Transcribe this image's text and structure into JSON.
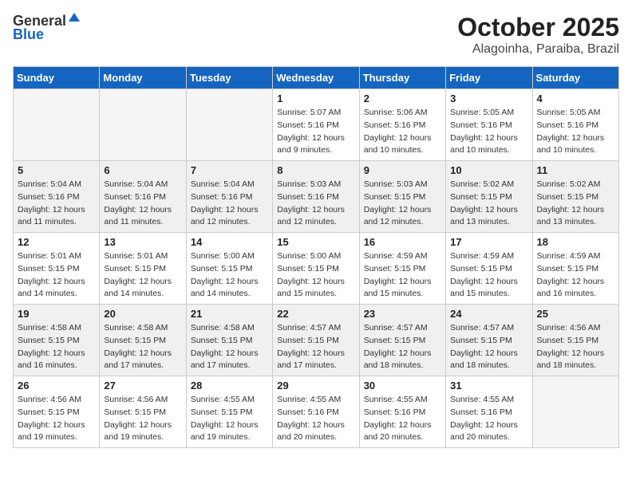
{
  "header": {
    "logo_general": "General",
    "logo_blue": "Blue",
    "title": "October 2025",
    "location": "Alagoinha, Paraiba, Brazil"
  },
  "weekdays": [
    "Sunday",
    "Monday",
    "Tuesday",
    "Wednesday",
    "Thursday",
    "Friday",
    "Saturday"
  ],
  "weeks": [
    [
      {
        "day": "",
        "info": ""
      },
      {
        "day": "",
        "info": ""
      },
      {
        "day": "",
        "info": ""
      },
      {
        "day": "1",
        "info": "Sunrise: 5:07 AM\nSunset: 5:16 PM\nDaylight: 12 hours\nand 9 minutes."
      },
      {
        "day": "2",
        "info": "Sunrise: 5:06 AM\nSunset: 5:16 PM\nDaylight: 12 hours\nand 10 minutes."
      },
      {
        "day": "3",
        "info": "Sunrise: 5:05 AM\nSunset: 5:16 PM\nDaylight: 12 hours\nand 10 minutes."
      },
      {
        "day": "4",
        "info": "Sunrise: 5:05 AM\nSunset: 5:16 PM\nDaylight: 12 hours\nand 10 minutes."
      }
    ],
    [
      {
        "day": "5",
        "info": "Sunrise: 5:04 AM\nSunset: 5:16 PM\nDaylight: 12 hours\nand 11 minutes."
      },
      {
        "day": "6",
        "info": "Sunrise: 5:04 AM\nSunset: 5:16 PM\nDaylight: 12 hours\nand 11 minutes."
      },
      {
        "day": "7",
        "info": "Sunrise: 5:04 AM\nSunset: 5:16 PM\nDaylight: 12 hours\nand 12 minutes."
      },
      {
        "day": "8",
        "info": "Sunrise: 5:03 AM\nSunset: 5:16 PM\nDaylight: 12 hours\nand 12 minutes."
      },
      {
        "day": "9",
        "info": "Sunrise: 5:03 AM\nSunset: 5:15 PM\nDaylight: 12 hours\nand 12 minutes."
      },
      {
        "day": "10",
        "info": "Sunrise: 5:02 AM\nSunset: 5:15 PM\nDaylight: 12 hours\nand 13 minutes."
      },
      {
        "day": "11",
        "info": "Sunrise: 5:02 AM\nSunset: 5:15 PM\nDaylight: 12 hours\nand 13 minutes."
      }
    ],
    [
      {
        "day": "12",
        "info": "Sunrise: 5:01 AM\nSunset: 5:15 PM\nDaylight: 12 hours\nand 14 minutes."
      },
      {
        "day": "13",
        "info": "Sunrise: 5:01 AM\nSunset: 5:15 PM\nDaylight: 12 hours\nand 14 minutes."
      },
      {
        "day": "14",
        "info": "Sunrise: 5:00 AM\nSunset: 5:15 PM\nDaylight: 12 hours\nand 14 minutes."
      },
      {
        "day": "15",
        "info": "Sunrise: 5:00 AM\nSunset: 5:15 PM\nDaylight: 12 hours\nand 15 minutes."
      },
      {
        "day": "16",
        "info": "Sunrise: 4:59 AM\nSunset: 5:15 PM\nDaylight: 12 hours\nand 15 minutes."
      },
      {
        "day": "17",
        "info": "Sunrise: 4:59 AM\nSunset: 5:15 PM\nDaylight: 12 hours\nand 15 minutes."
      },
      {
        "day": "18",
        "info": "Sunrise: 4:59 AM\nSunset: 5:15 PM\nDaylight: 12 hours\nand 16 minutes."
      }
    ],
    [
      {
        "day": "19",
        "info": "Sunrise: 4:58 AM\nSunset: 5:15 PM\nDaylight: 12 hours\nand 16 minutes."
      },
      {
        "day": "20",
        "info": "Sunrise: 4:58 AM\nSunset: 5:15 PM\nDaylight: 12 hours\nand 17 minutes."
      },
      {
        "day": "21",
        "info": "Sunrise: 4:58 AM\nSunset: 5:15 PM\nDaylight: 12 hours\nand 17 minutes."
      },
      {
        "day": "22",
        "info": "Sunrise: 4:57 AM\nSunset: 5:15 PM\nDaylight: 12 hours\nand 17 minutes."
      },
      {
        "day": "23",
        "info": "Sunrise: 4:57 AM\nSunset: 5:15 PM\nDaylight: 12 hours\nand 18 minutes."
      },
      {
        "day": "24",
        "info": "Sunrise: 4:57 AM\nSunset: 5:15 PM\nDaylight: 12 hours\nand 18 minutes."
      },
      {
        "day": "25",
        "info": "Sunrise: 4:56 AM\nSunset: 5:15 PM\nDaylight: 12 hours\nand 18 minutes."
      }
    ],
    [
      {
        "day": "26",
        "info": "Sunrise: 4:56 AM\nSunset: 5:15 PM\nDaylight: 12 hours\nand 19 minutes."
      },
      {
        "day": "27",
        "info": "Sunrise: 4:56 AM\nSunset: 5:15 PM\nDaylight: 12 hours\nand 19 minutes."
      },
      {
        "day": "28",
        "info": "Sunrise: 4:55 AM\nSunset: 5:15 PM\nDaylight: 12 hours\nand 19 minutes."
      },
      {
        "day": "29",
        "info": "Sunrise: 4:55 AM\nSunset: 5:16 PM\nDaylight: 12 hours\nand 20 minutes."
      },
      {
        "day": "30",
        "info": "Sunrise: 4:55 AM\nSunset: 5:16 PM\nDaylight: 12 hours\nand 20 minutes."
      },
      {
        "day": "31",
        "info": "Sunrise: 4:55 AM\nSunset: 5:16 PM\nDaylight: 12 hours\nand 20 minutes."
      },
      {
        "day": "",
        "info": ""
      }
    ]
  ]
}
